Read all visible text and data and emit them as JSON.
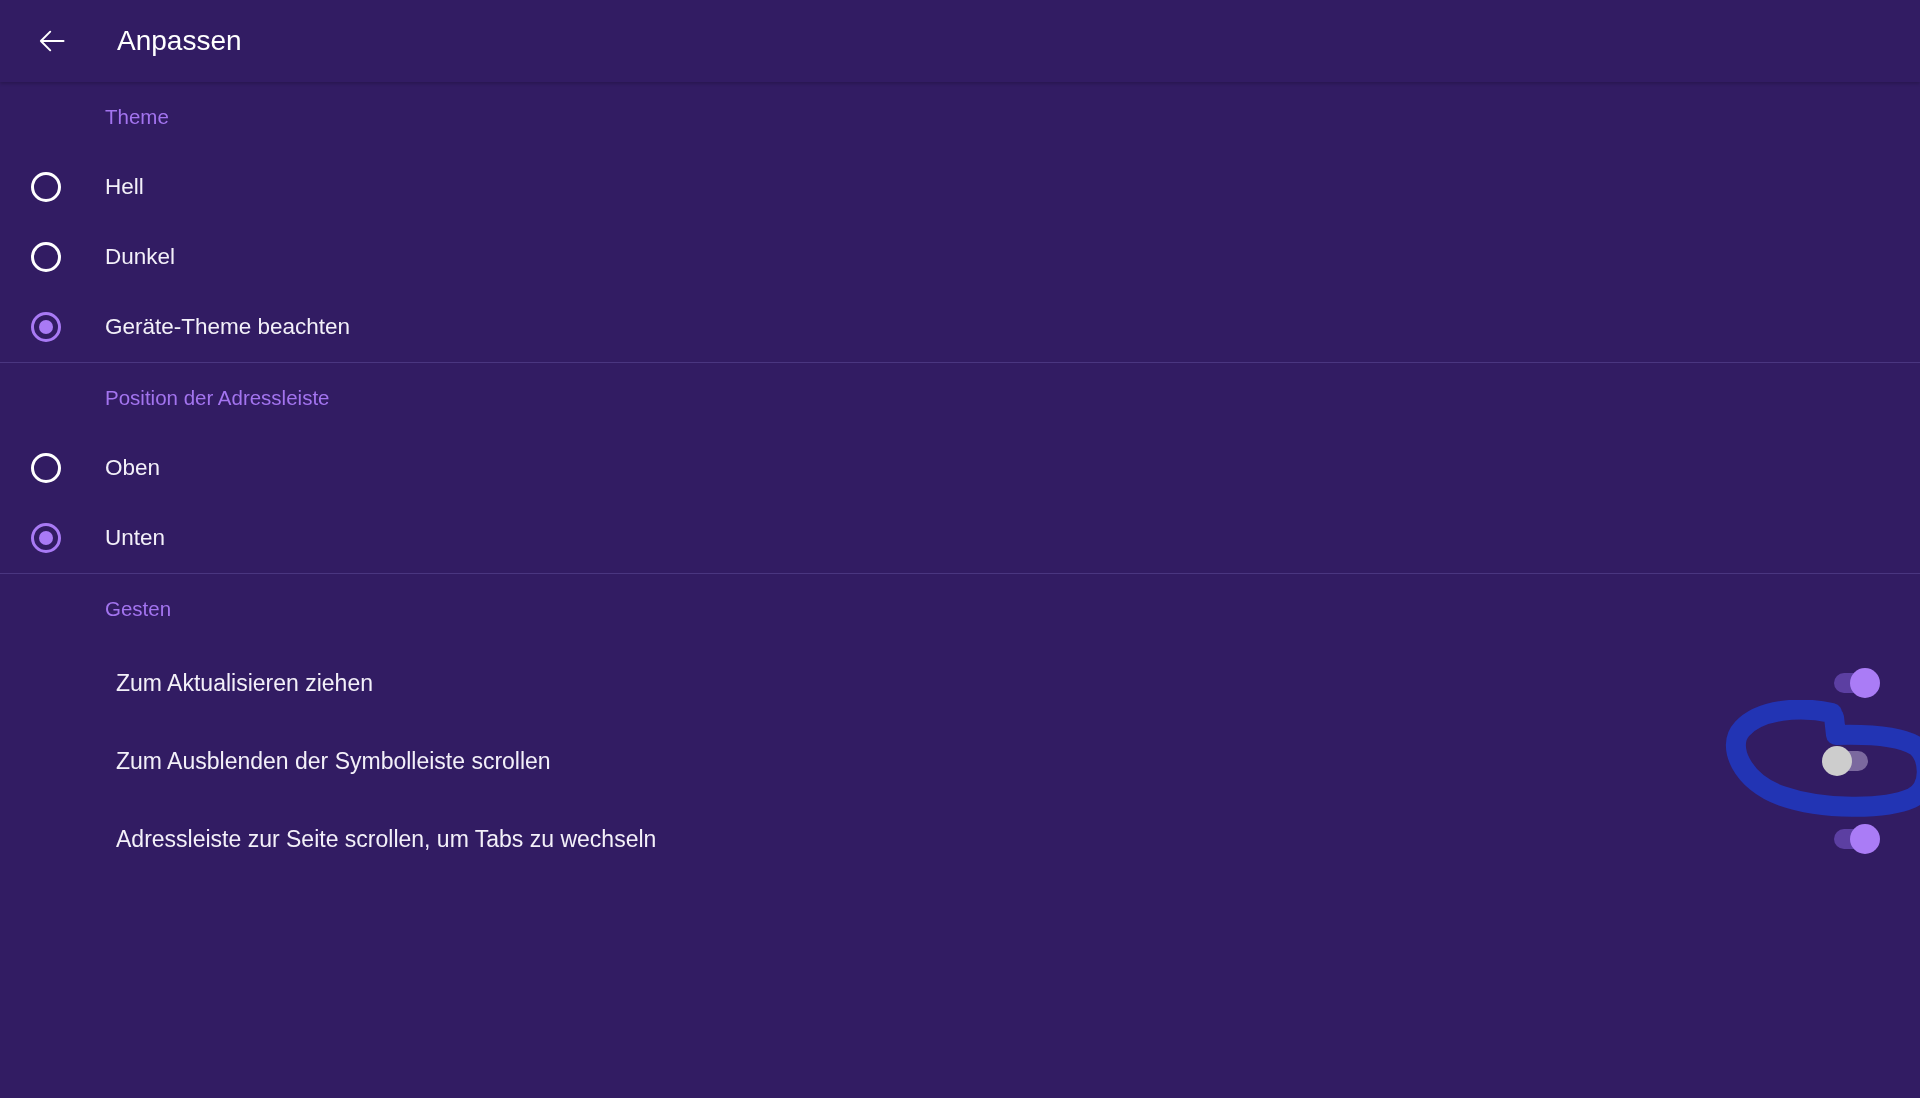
{
  "header": {
    "title": "Anpassen"
  },
  "sections": [
    {
      "title": "Theme",
      "kind": "radio",
      "items": [
        {
          "label": "Hell",
          "selected": false
        },
        {
          "label": "Dunkel",
          "selected": false
        },
        {
          "label": "Geräte-Theme beachten",
          "selected": true
        }
      ]
    },
    {
      "title": "Position der Adressleiste",
      "kind": "radio",
      "items": [
        {
          "label": "Oben",
          "selected": false
        },
        {
          "label": "Unten",
          "selected": true
        }
      ]
    },
    {
      "title": "Gesten",
      "kind": "toggle",
      "items": [
        {
          "label": "Zum Aktualisieren ziehen",
          "on": true
        },
        {
          "label": "Zum Ausblenden der Symbolleiste scrollen",
          "on": false,
          "circled": true
        },
        {
          "label": "Adressleiste zur Seite scrollen, um Tabs zu wechseln",
          "on": true
        }
      ]
    }
  ]
}
